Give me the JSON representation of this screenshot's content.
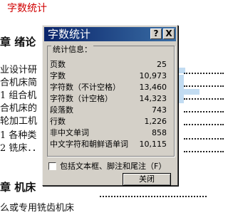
{
  "document": {
    "header": "字数统计",
    "lines": [
      "章  绪论",
      "业设计研",
      "合机床简",
      "1 组合机",
      "合机床的",
      "轮加工机",
      "1 各种类",
      "2 铣床．．",
      "章  机床",
      "么或专用铣齿机床"
    ]
  },
  "dialog": {
    "title": "字数统计",
    "help_button": "?",
    "close_button": "X",
    "group_label": "统计信息：",
    "stats": [
      {
        "label": "页数",
        "value": "25"
      },
      {
        "label": "字数",
        "value": "10,973"
      },
      {
        "label": "字符数（不计空格）",
        "value": "13,460"
      },
      {
        "label": "字符数（计空格）",
        "value": "14,323"
      },
      {
        "label": "段落数",
        "value": "743"
      },
      {
        "label": "行数",
        "value": "1,226"
      },
      {
        "label": "非中文单词",
        "value": "858"
      },
      {
        "label": "中文字符和朝鲜语单词",
        "value": "10,115"
      }
    ],
    "checkbox_label": "包括文本框、脚注和尾注（F）",
    "checkbox_checked": false,
    "close_label": "关闭"
  },
  "colors": {
    "titlebar_start": "#0a246a",
    "titlebar_end": "#3a6ea5",
    "dialog_bg": "#d4d0c8",
    "header_text": "#d00000"
  },
  "watermark": {
    "icon": "watermark-logo-icon"
  }
}
